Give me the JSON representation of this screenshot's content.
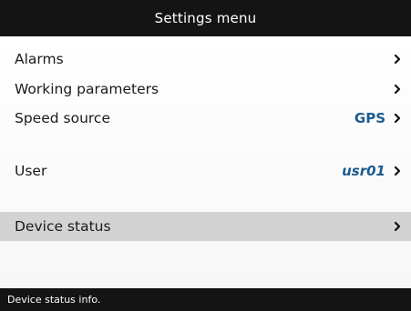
{
  "header": {
    "title": "Settings menu"
  },
  "menu": {
    "items": [
      {
        "label": "Alarms",
        "value": ""
      },
      {
        "label": "Working parameters",
        "value": ""
      },
      {
        "label": "Speed source",
        "value": "GPS"
      },
      {
        "label": "User",
        "value": "usr01"
      },
      {
        "label": "Device status",
        "value": ""
      }
    ],
    "selected": "Device status"
  },
  "status": {
    "text": "Device status info."
  },
  "colors": {
    "bar_background": "#141414",
    "value_text": "#1d5b8f",
    "selected_row": "#d3d3d3"
  }
}
